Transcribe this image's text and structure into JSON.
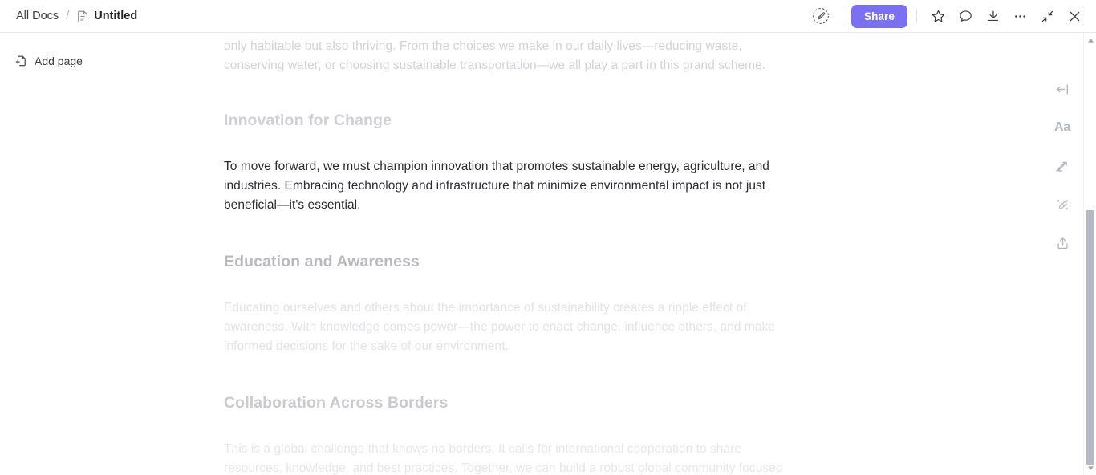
{
  "header": {
    "breadcrumb": {
      "root_label": "All Docs",
      "separator": "/",
      "current_label": "Untitled",
      "doc_icon": "document-icon"
    },
    "edit_mode_icon": "edit-pen-circle-icon",
    "share_label": "Share",
    "actions": [
      {
        "name": "favorite-star-icon",
        "icon": "star-icon"
      },
      {
        "name": "comment-icon",
        "icon": "speech-bubble-icon"
      },
      {
        "name": "scroll-to-bottom-icon",
        "icon": "arrow-down-to-line-icon"
      },
      {
        "name": "more-options-icon",
        "icon": "ellipsis-icon"
      },
      {
        "name": "collapse-window-icon",
        "icon": "minimize-arrows-icon"
      },
      {
        "name": "close-icon",
        "icon": "close-x-icon"
      }
    ]
  },
  "sidebar": {
    "add_page_label": "Add page",
    "add_page_icon": "add-page-icon"
  },
  "right_rail": {
    "items": [
      {
        "name": "collapse-panel-icon",
        "label": ""
      },
      {
        "name": "text-style-icon",
        "label": "Aa"
      },
      {
        "name": "translate-swap-icon",
        "label": ""
      },
      {
        "name": "ai-magic-wand-icon",
        "label": ""
      },
      {
        "name": "upload-export-icon",
        "label": ""
      }
    ]
  },
  "scrollbar": {
    "up_arrow": "scroll-up-arrow",
    "down_arrow": "scroll-down-arrow",
    "thumb": "scrollbar-thumb"
  },
  "document": {
    "blocks": [
      {
        "type": "paragraph",
        "opacity": "fade-1",
        "text": "only habitable but also thriving. From the choices we make in our daily lives—reducing waste, conserving water, or choosing sustainable transportation—we all play a part in this grand scheme."
      },
      {
        "type": "heading",
        "opacity": "fade-1h",
        "text": "Innovation for Change"
      },
      {
        "type": "paragraph",
        "opacity": "solid",
        "text": "To move forward, we must champion innovation that promotes sustainable energy, agriculture, and industries. Embracing technology and infrastructure that minimize environmental impact is not just beneficial—it's essential."
      },
      {
        "type": "heading",
        "opacity": "solid-h",
        "text": "Education and Awareness"
      },
      {
        "type": "paragraph",
        "opacity": "fade-2",
        "text": "Educating ourselves and others about the importance of sustainability creates a ripple effect of awareness. With knowledge comes power—the power to enact change, influence others, and make informed decisions for the sake of our environment."
      },
      {
        "type": "heading",
        "opacity": "fade-2h",
        "text": "Collaboration Across Borders"
      },
      {
        "type": "paragraph",
        "opacity": "fade-3",
        "text": "This is a global challenge that knows no borders. It calls for international cooperation to share resources, knowledge, and best practices. Together, we can build a robust global community focused"
      }
    ]
  },
  "colors": {
    "accent": "#7b71f0",
    "text": "#2b2c32",
    "muted": "#b3b7c2",
    "border": "#e9e9ec",
    "scrollbar_thumb": "#b4b9c3"
  }
}
